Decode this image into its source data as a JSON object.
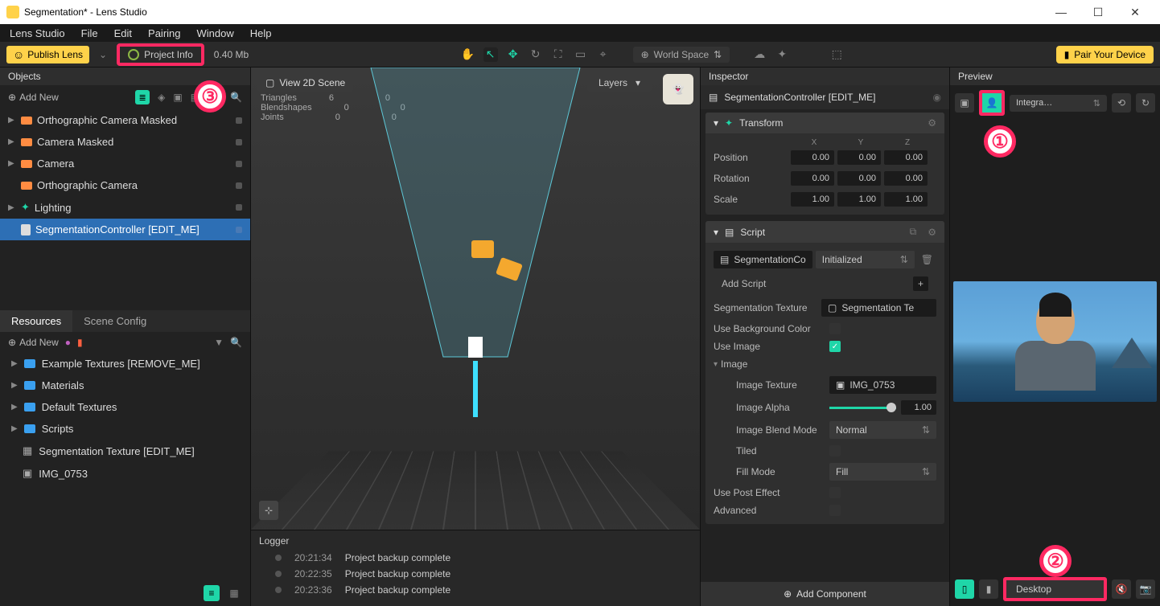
{
  "window": {
    "title": "Segmentation* - Lens Studio",
    "min": "—",
    "max": "☐",
    "close": "✕"
  },
  "menu": {
    "items": [
      "Lens Studio",
      "File",
      "Edit",
      "Pairing",
      "Window",
      "Help"
    ]
  },
  "toolbar": {
    "publish": "Publish Lens",
    "project_info": "Project Info",
    "size": "0.40 Mb",
    "world_space": "World Space",
    "pair": "Pair Your Device"
  },
  "annotations": {
    "a1": "①",
    "a2": "②",
    "a3": "③"
  },
  "objects": {
    "title": "Objects",
    "add": "Add New",
    "items": [
      {
        "label": "Orthographic Camera Masked",
        "icon": "cam",
        "expand": true
      },
      {
        "label": "Camera Masked",
        "icon": "cam",
        "expand": true
      },
      {
        "label": "Camera",
        "icon": "cam",
        "expand": true
      },
      {
        "label": "Orthographic Camera",
        "icon": "cam",
        "expand": false
      },
      {
        "label": "Lighting",
        "icon": "light",
        "expand": true
      },
      {
        "label": "SegmentationController [EDIT_ME]",
        "icon": "script",
        "expand": false,
        "selected": true
      }
    ]
  },
  "resources": {
    "tabs": [
      "Resources",
      "Scene Config"
    ],
    "add": "Add New",
    "items": [
      {
        "label": "Example Textures [REMOVE_ME]",
        "type": "folder",
        "expand": true
      },
      {
        "label": "Materials",
        "type": "folder",
        "expand": true
      },
      {
        "label": "Default Textures",
        "type": "folder",
        "expand": true
      },
      {
        "label": "Scripts",
        "type": "folder",
        "expand": true
      },
      {
        "label": "Segmentation Texture [EDIT_ME]",
        "type": "file"
      },
      {
        "label": "IMG_0753",
        "type": "file"
      }
    ]
  },
  "viewport": {
    "view2d": "View 2D Scene",
    "layers": "Layers",
    "stats": {
      "triangles_label": "Triangles",
      "triangles": "6",
      "blendshapes_label": "Blendshapes",
      "blendshapes": "0",
      "joints_label": "Joints",
      "joints": "0",
      "tri_col2": "0",
      "bs_col2": "0",
      "jt_col2": "0"
    }
  },
  "logger": {
    "title": "Logger",
    "entries": [
      {
        "time": "20:21:34",
        "msg": "Project backup complete"
      },
      {
        "time": "20:22:35",
        "msg": "Project backup complete"
      },
      {
        "time": "20:23:36",
        "msg": "Project backup complete"
      }
    ]
  },
  "inspector": {
    "title": "Inspector",
    "object": "SegmentationController [EDIT_ME]",
    "transform": {
      "title": "Transform",
      "position_label": "Position",
      "rotation_label": "Rotation",
      "scale_label": "Scale",
      "x_label": "X",
      "y_label": "Y",
      "z_label": "Z",
      "pos": {
        "x": "0.00",
        "y": "0.00",
        "z": "0.00"
      },
      "rot": {
        "x": "0.00",
        "y": "0.00",
        "z": "0.00"
      },
      "scale": {
        "x": "1.00",
        "y": "1.00",
        "z": "1.00"
      }
    },
    "script": {
      "title": "Script",
      "ref": "SegmentationCo",
      "state": "Initialized",
      "add_script": "Add Script",
      "seg_texture_label": "Segmentation Texture",
      "seg_texture_value": "Segmentation Te",
      "use_bg_label": "Use Background Color",
      "use_image_label": "Use Image",
      "image_group": "Image",
      "image_texture_label": "Image Texture",
      "image_texture_value": "IMG_0753",
      "image_alpha_label": "Image Alpha",
      "image_alpha_value": "1.00",
      "blend_mode_label": "Image Blend Mode",
      "blend_mode_value": "Normal",
      "tiled_label": "Tiled",
      "fill_mode_label": "Fill Mode",
      "fill_mode_value": "Fill",
      "post_effect_label": "Use Post Effect",
      "advanced_label": "Advanced"
    },
    "add_component": "Add Component"
  },
  "preview": {
    "title": "Preview",
    "mode": "Integra…",
    "desktop": "Desktop"
  }
}
